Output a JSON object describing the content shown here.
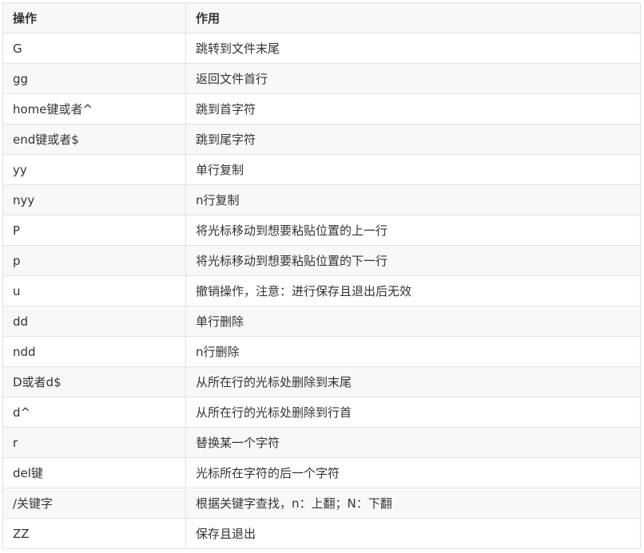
{
  "table": {
    "headers": [
      "操作",
      "作用"
    ],
    "rows": [
      {
        "op": "G",
        "desc": "跳转到文件末尾"
      },
      {
        "op": "gg",
        "desc": "返回文件首行"
      },
      {
        "op": "home键或者^",
        "desc": "跳到首字符"
      },
      {
        "op": "end键或者$",
        "desc": "跳到尾字符"
      },
      {
        "op": "yy",
        "desc": "单行复制"
      },
      {
        "op": "nyy",
        "desc": "n行复制"
      },
      {
        "op": "P",
        "desc": "将光标移动到想要粘贴位置的上一行"
      },
      {
        "op": "p",
        "desc": "将光标移动到想要粘贴位置的下一行"
      },
      {
        "op": "u",
        "desc": "撤销操作，注意：进行保存且退出后无效"
      },
      {
        "op": "dd",
        "desc": "单行删除"
      },
      {
        "op": "ndd",
        "desc": "n行删除"
      },
      {
        "op": "D或者d$",
        "desc": "从所在行的光标处删除到末尾"
      },
      {
        "op": "d^",
        "desc": "从所在行的光标处删除到行首"
      },
      {
        "op": "r",
        "desc": "替换某一个字符"
      },
      {
        "op": "del键",
        "desc": "光标所在字符的后一个字符"
      },
      {
        "op": "/关键字",
        "desc": "根据关键字查找，n：上翻；N：下翻"
      },
      {
        "op": "ZZ",
        "desc": "保存且退出"
      }
    ]
  }
}
